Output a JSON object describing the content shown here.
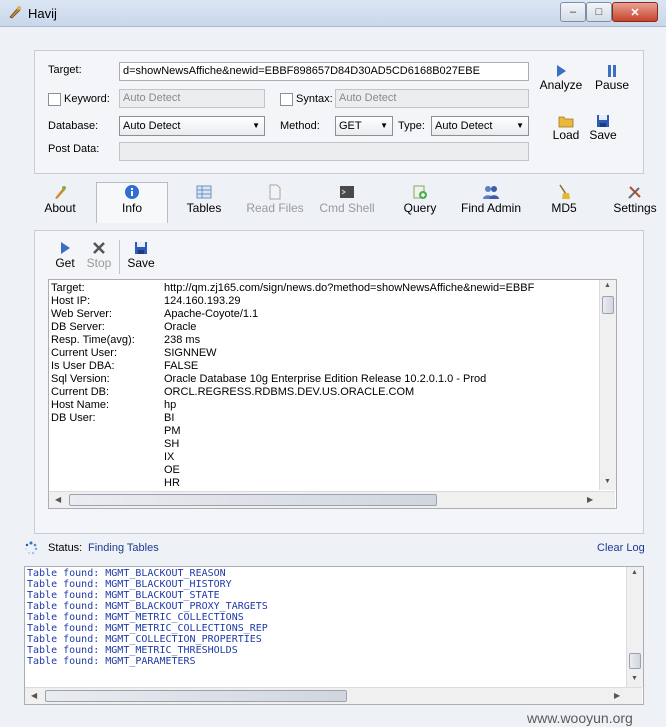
{
  "window": {
    "title": "Havij",
    "minimize": "–",
    "maximize": "□",
    "close": "✕"
  },
  "form": {
    "target_label": "Target:",
    "target_value": "d=showNewsAffiche&newid=EBBF898657D84D30AD5CD6168B027EBE",
    "keyword_label": "Keyword:",
    "keyword_placeholder": "Auto Detect",
    "syntax_label": "Syntax:",
    "syntax_placeholder": "Auto Detect",
    "database_label": "Database:",
    "database_value": "Auto Detect",
    "method_label": "Method:",
    "method_value": "GET",
    "type_label": "Type:",
    "type_value": "Auto Detect",
    "postdata_label": "Post Data:"
  },
  "actions": {
    "analyze": "Analyze",
    "pause": "Pause",
    "load": "Load",
    "save": "Save"
  },
  "tabs": {
    "about": "About",
    "info": "Info",
    "tables": "Tables",
    "read_files": "Read Files",
    "cmd_shell": "Cmd Shell",
    "query": "Query",
    "find_admin": "Find Admin",
    "md5": "MD5",
    "settings": "Settings"
  },
  "info_toolbar": {
    "get": "Get",
    "stop": "Stop",
    "save": "Save"
  },
  "info": {
    "rows": [
      {
        "k": "Target:",
        "v": "http://qm.zj165.com/sign/news.do?method=showNewsAffiche&newid=EBBF"
      },
      {
        "k": "Host IP:",
        "v": "124.160.193.29"
      },
      {
        "k": "Web Server:",
        "v": "Apache-Coyote/1.1"
      },
      {
        "k": "DB Server:",
        "v": "Oracle"
      },
      {
        "k": "Resp. Time(avg):",
        "v": "238 ms"
      },
      {
        "k": "Current User:",
        "v": "SIGNNEW"
      },
      {
        "k": "Is User DBA:",
        "v": "FALSE"
      },
      {
        "k": "Sql Version:",
        "v": "Oracle Database 10g Enterprise Edition Release 10.2.0.1.0 - Prod"
      },
      {
        "k": "Current DB:",
        "v": "ORCL.REGRESS.RDBMS.DEV.US.ORACLE.COM"
      },
      {
        "k": "Host Name:",
        "v": "hp"
      },
      {
        "k": "DB User:",
        "v": "BI"
      },
      {
        "k": "",
        "v": "PM"
      },
      {
        "k": "",
        "v": "SH"
      },
      {
        "k": "",
        "v": "IX"
      },
      {
        "k": "",
        "v": "OE"
      },
      {
        "k": "",
        "v": "HR"
      }
    ]
  },
  "status": {
    "label": "Status:",
    "value": "Finding Tables",
    "clear_log": "Clear Log"
  },
  "log": [
    "Table found: MGMT_BLACKOUT_REASON",
    "Table found: MGMT_BLACKOUT_HISTORY",
    "Table found: MGMT_BLACKOUT_STATE",
    "Table found: MGMT_BLACKOUT_PROXY_TARGETS",
    "Table found: MGMT_METRIC_COLLECTIONS",
    "Table found: MGMT_METRIC_COLLECTIONS_REP",
    "Table found: MGMT_COLLECTION_PROPERTIES",
    "Table found: MGMT_METRIC_THRESHOLDS",
    "Table found: MGMT_PARAMETERS"
  ],
  "watermark": "www.wooyun.org"
}
